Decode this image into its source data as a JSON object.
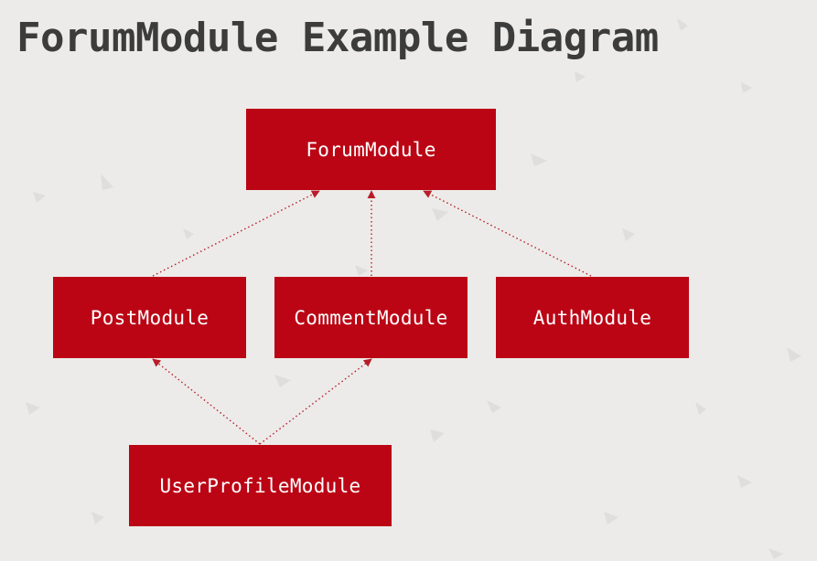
{
  "diagram": {
    "title": "ForumModule Example Diagram",
    "node_color": "#bb0515",
    "edge_color": "#b81c28",
    "edge_style": "dotted-arrow",
    "nodes": [
      {
        "id": "forum",
        "label": "ForumModule"
      },
      {
        "id": "post",
        "label": "PostModule"
      },
      {
        "id": "comment",
        "label": "CommentModule"
      },
      {
        "id": "auth",
        "label": "AuthModule"
      },
      {
        "id": "user",
        "label": "UserProfileModule"
      }
    ],
    "edges": [
      {
        "from": "post",
        "to": "forum"
      },
      {
        "from": "comment",
        "to": "forum"
      },
      {
        "from": "auth",
        "to": "forum"
      },
      {
        "from": "user",
        "to": "post"
      },
      {
        "from": "user",
        "to": "comment"
      }
    ]
  }
}
